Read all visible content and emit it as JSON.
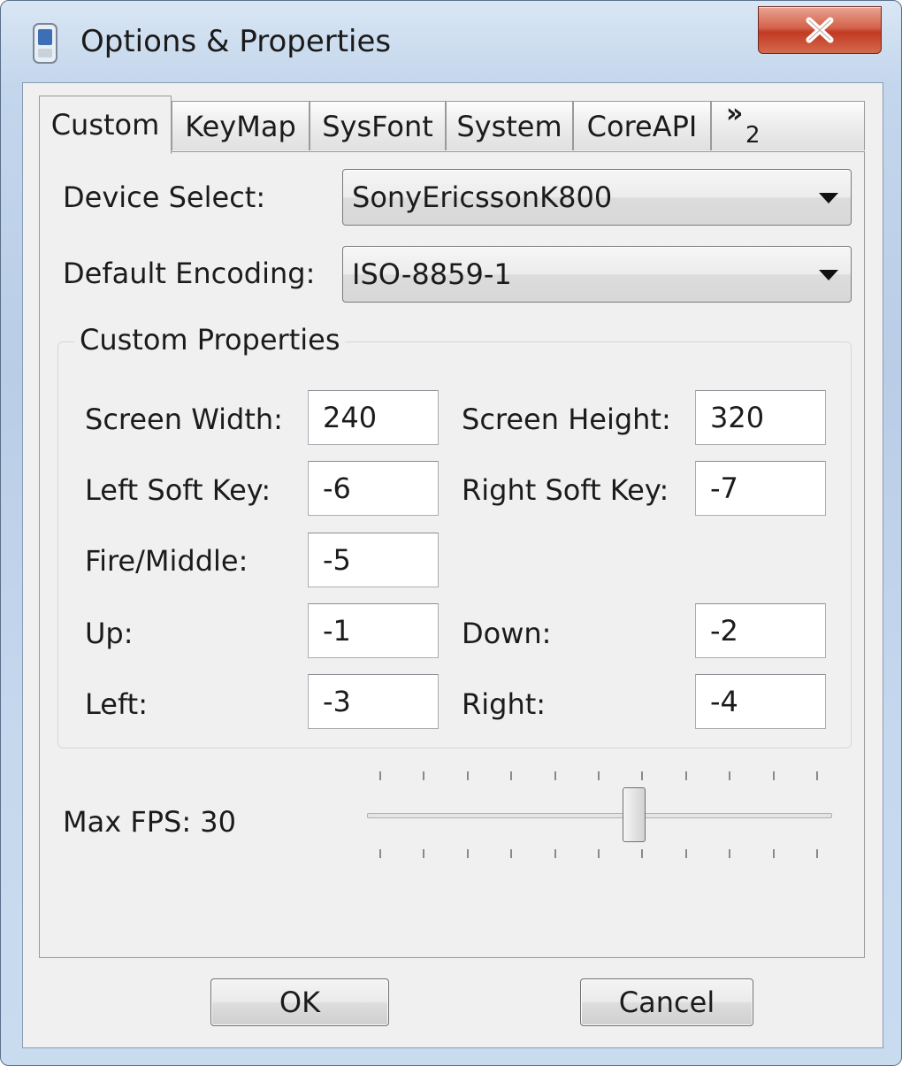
{
  "window": {
    "title": "Options & Properties",
    "close_glyph": "✕"
  },
  "tabs": [
    {
      "label": "Custom",
      "active": true
    },
    {
      "label": "KeyMap"
    },
    {
      "label": "SysFont"
    },
    {
      "label": "System"
    },
    {
      "label": "CoreAPI"
    },
    {
      "label": "»",
      "sub": "2"
    }
  ],
  "device_select": {
    "label": "Device Select:",
    "value": "SonyEricssonK800"
  },
  "default_encoding": {
    "label": "Default Encoding:",
    "value": "ISO-8859-1"
  },
  "custom_properties": {
    "title": "Custom Properties",
    "screen_width": {
      "label": "Screen Width:",
      "value": "240"
    },
    "screen_height": {
      "label": "Screen Height:",
      "value": "320"
    },
    "left_soft_key": {
      "label": "Left Soft Key:",
      "value": "-6"
    },
    "right_soft_key": {
      "label": "Right Soft Key:",
      "value": "-7"
    },
    "fire_middle": {
      "label": "Fire/Middle:",
      "value": "-5"
    },
    "up": {
      "label": "Up:",
      "value": "-1"
    },
    "down": {
      "label": "Down:",
      "value": "-2"
    },
    "left": {
      "label": "Left:",
      "value": "-3"
    },
    "right": {
      "label": "Right:",
      "value": "-4"
    }
  },
  "max_fps": {
    "label": "Max FPS: 30",
    "slider_fraction": 0.58
  },
  "buttons": {
    "ok": "OK",
    "cancel": "Cancel"
  },
  "colors": {
    "close_button": "#c7432b",
    "frame": "#c3d6ec",
    "dialog_bg": "#f0f0f0"
  },
  "icons": {
    "app": "mobile-phone-icon",
    "close": "close-icon"
  }
}
